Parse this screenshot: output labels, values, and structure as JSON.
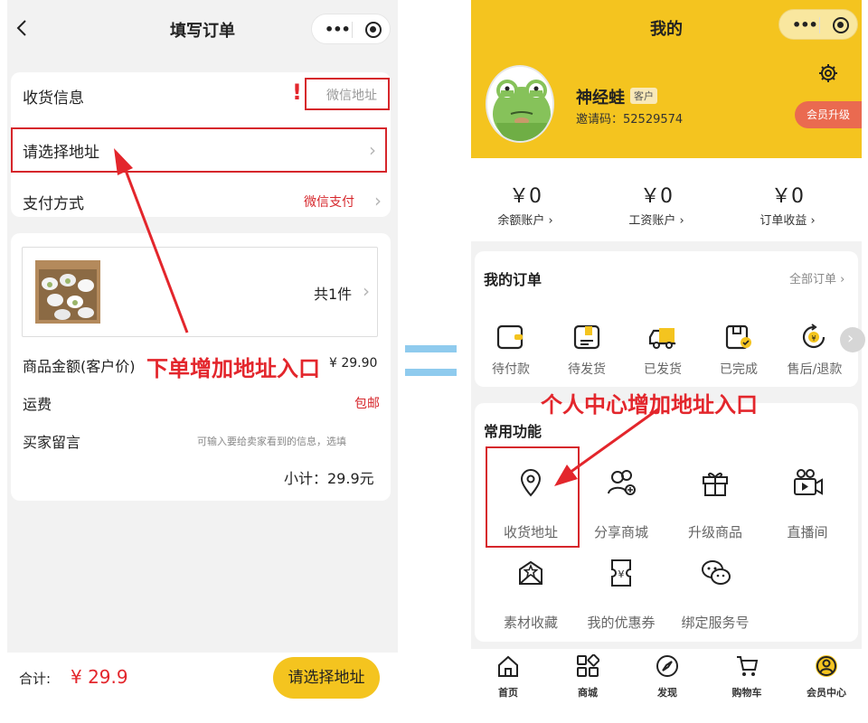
{
  "left": {
    "nav_title": "填写订单",
    "address": {
      "receiver_label": "收货信息",
      "wechat_address": "微信地址",
      "exclamation": "!",
      "select_address": "请选择地址"
    },
    "payment": {
      "label": "支付方式",
      "value": "微信支付"
    },
    "product": {
      "count": "共1件"
    },
    "rows": {
      "amount_label": "商品金额(客户价)",
      "amount_value": "¥ 29.90",
      "shipping_label": "运费",
      "shipping_value": "包邮",
      "message_label": "买家留言",
      "message_placeholder": "可输入要给卖家看到的信息，选填",
      "subtotal": "小计：29.9元"
    },
    "annotation": "下单增加地址入口",
    "footer": {
      "total_label": "合计:",
      "total_value": "¥ 29.9",
      "submit_label": "请选择地址"
    }
  },
  "right": {
    "nav_title": "我的",
    "profile": {
      "name": "神经蛙",
      "role_badge": "客户",
      "invite": "邀请码：52529574",
      "upgrade_button": "会员升级"
    },
    "stats": [
      {
        "value": "￥0",
        "label": "余额账户"
      },
      {
        "value": "￥0",
        "label": "工资账户"
      },
      {
        "value": "￥0",
        "label": "订单收益"
      }
    ],
    "orders": {
      "title": "我的订单",
      "all_link": "全部订单",
      "items": [
        {
          "label": "待付款",
          "icon": "wallet-icon"
        },
        {
          "label": "待发货",
          "icon": "package-icon"
        },
        {
          "label": "已发货",
          "icon": "truck-icon"
        },
        {
          "label": "已完成",
          "icon": "completed-box-icon"
        },
        {
          "label": "售后/退款",
          "icon": "refund-icon"
        }
      ]
    },
    "annotation": "个人中心增加地址入口",
    "functions": {
      "title": "常用功能",
      "items": [
        {
          "label": "收货地址",
          "icon": "location-pin-icon"
        },
        {
          "label": "分享商城",
          "icon": "share-users-icon"
        },
        {
          "label": "升级商品",
          "icon": "gift-icon"
        },
        {
          "label": "直播间",
          "icon": "live-camera-icon"
        },
        {
          "label": "素材收藏",
          "icon": "star-mail-icon"
        },
        {
          "label": "我的优惠券",
          "icon": "coupon-icon"
        },
        {
          "label": "绑定服务号",
          "icon": "wechat-icon"
        }
      ]
    },
    "tabbar": [
      {
        "label": "首页",
        "icon": "home-icon"
      },
      {
        "label": "商城",
        "icon": "grid-icon"
      },
      {
        "label": "发现",
        "icon": "compass-icon"
      },
      {
        "label": "购物车",
        "icon": "cart-icon"
      },
      {
        "label": "会员中心",
        "icon": "user-circle-icon"
      }
    ]
  },
  "colors": {
    "brand_yellow": "#f4c41f",
    "annotation_red": "#e3262c",
    "price_red": "#e3262c",
    "background": "#f2f2f2",
    "equal_sign": "#8fcbee"
  }
}
